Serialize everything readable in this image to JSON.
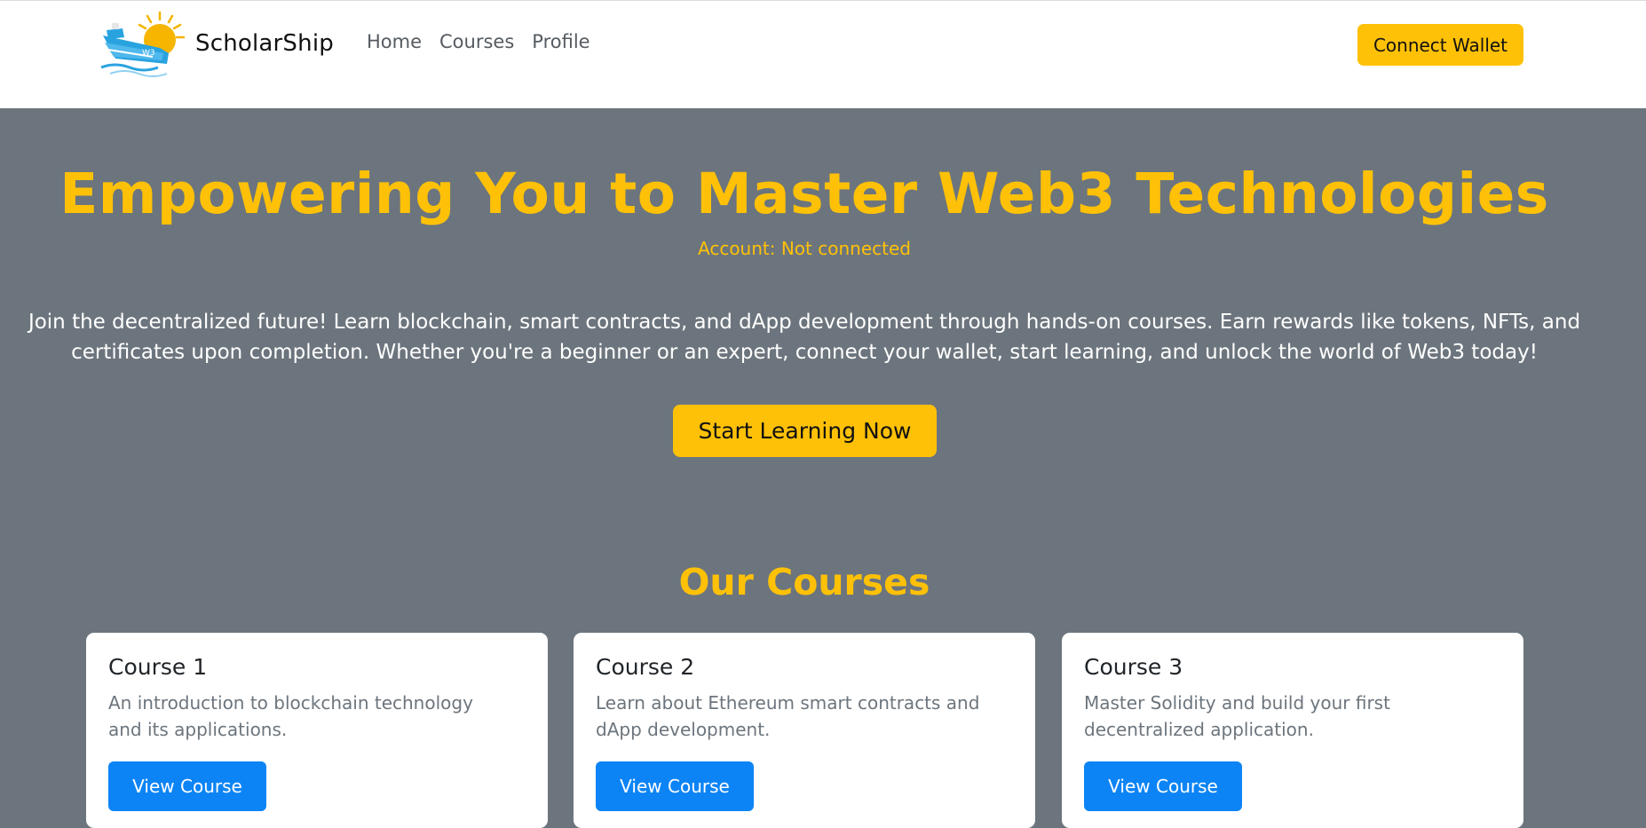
{
  "nav": {
    "brand": "ScholarShip",
    "links": [
      "Home",
      "Courses",
      "Profile"
    ],
    "connect_label": "Connect Wallet"
  },
  "hero": {
    "title": "Empowering You to Master Web3 Technologies",
    "account": "Account: Not connected",
    "description": "Join the decentralized future! Learn blockchain, smart contracts, and dApp development through hands-on courses. Earn rewards like tokens, NFTs, and certificates upon completion. Whether you're a beginner or an expert, connect your wallet, start learning, and unlock the world of Web3 today!",
    "cta_label": "Start Learning Now"
  },
  "courses": {
    "title": "Our Courses",
    "items": [
      {
        "title": "Course 1",
        "text": "An introduction to blockchain technology and its applications.",
        "button": "View Course"
      },
      {
        "title": "Course 2",
        "text": "Learn about Ethereum smart contracts and dApp development.",
        "button": "View Course"
      },
      {
        "title": "Course 3",
        "text": "Master Solidity and build your first decentralized application.",
        "button": "View Course"
      }
    ]
  },
  "colors": {
    "accent": "#ffc107",
    "background": "#6c757d",
    "primary_button": "#0d84f5"
  },
  "icons": {
    "logo": "ship-sun-logo"
  }
}
